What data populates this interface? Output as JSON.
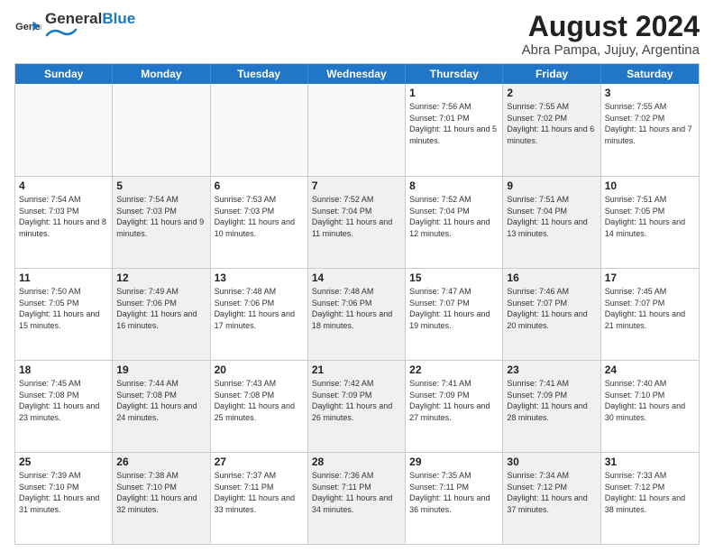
{
  "header": {
    "logo_general": "General",
    "logo_blue": "Blue",
    "month_year": "August 2024",
    "location": "Abra Pampa, Jujuy, Argentina"
  },
  "weekdays": [
    "Sunday",
    "Monday",
    "Tuesday",
    "Wednesday",
    "Thursday",
    "Friday",
    "Saturday"
  ],
  "rows": [
    [
      {
        "day": "",
        "info": "",
        "shaded": false,
        "empty": true
      },
      {
        "day": "",
        "info": "",
        "shaded": false,
        "empty": true
      },
      {
        "day": "",
        "info": "",
        "shaded": false,
        "empty": true
      },
      {
        "day": "",
        "info": "",
        "shaded": false,
        "empty": true
      },
      {
        "day": "1",
        "info": "Sunrise: 7:56 AM\nSunset: 7:01 PM\nDaylight: 11 hours\nand 5 minutes.",
        "shaded": false,
        "empty": false
      },
      {
        "day": "2",
        "info": "Sunrise: 7:55 AM\nSunset: 7:02 PM\nDaylight: 11 hours\nand 6 minutes.",
        "shaded": true,
        "empty": false
      },
      {
        "day": "3",
        "info": "Sunrise: 7:55 AM\nSunset: 7:02 PM\nDaylight: 11 hours\nand 7 minutes.",
        "shaded": false,
        "empty": false
      }
    ],
    [
      {
        "day": "4",
        "info": "Sunrise: 7:54 AM\nSunset: 7:03 PM\nDaylight: 11 hours\nand 8 minutes.",
        "shaded": false,
        "empty": false
      },
      {
        "day": "5",
        "info": "Sunrise: 7:54 AM\nSunset: 7:03 PM\nDaylight: 11 hours\nand 9 minutes.",
        "shaded": true,
        "empty": false
      },
      {
        "day": "6",
        "info": "Sunrise: 7:53 AM\nSunset: 7:03 PM\nDaylight: 11 hours\nand 10 minutes.",
        "shaded": false,
        "empty": false
      },
      {
        "day": "7",
        "info": "Sunrise: 7:52 AM\nSunset: 7:04 PM\nDaylight: 11 hours\nand 11 minutes.",
        "shaded": true,
        "empty": false
      },
      {
        "day": "8",
        "info": "Sunrise: 7:52 AM\nSunset: 7:04 PM\nDaylight: 11 hours\nand 12 minutes.",
        "shaded": false,
        "empty": false
      },
      {
        "day": "9",
        "info": "Sunrise: 7:51 AM\nSunset: 7:04 PM\nDaylight: 11 hours\nand 13 minutes.",
        "shaded": true,
        "empty": false
      },
      {
        "day": "10",
        "info": "Sunrise: 7:51 AM\nSunset: 7:05 PM\nDaylight: 11 hours\nand 14 minutes.",
        "shaded": false,
        "empty": false
      }
    ],
    [
      {
        "day": "11",
        "info": "Sunrise: 7:50 AM\nSunset: 7:05 PM\nDaylight: 11 hours\nand 15 minutes.",
        "shaded": false,
        "empty": false
      },
      {
        "day": "12",
        "info": "Sunrise: 7:49 AM\nSunset: 7:06 PM\nDaylight: 11 hours\nand 16 minutes.",
        "shaded": true,
        "empty": false
      },
      {
        "day": "13",
        "info": "Sunrise: 7:48 AM\nSunset: 7:06 PM\nDaylight: 11 hours\nand 17 minutes.",
        "shaded": false,
        "empty": false
      },
      {
        "day": "14",
        "info": "Sunrise: 7:48 AM\nSunset: 7:06 PM\nDaylight: 11 hours\nand 18 minutes.",
        "shaded": true,
        "empty": false
      },
      {
        "day": "15",
        "info": "Sunrise: 7:47 AM\nSunset: 7:07 PM\nDaylight: 11 hours\nand 19 minutes.",
        "shaded": false,
        "empty": false
      },
      {
        "day": "16",
        "info": "Sunrise: 7:46 AM\nSunset: 7:07 PM\nDaylight: 11 hours\nand 20 minutes.",
        "shaded": true,
        "empty": false
      },
      {
        "day": "17",
        "info": "Sunrise: 7:45 AM\nSunset: 7:07 PM\nDaylight: 11 hours\nand 21 minutes.",
        "shaded": false,
        "empty": false
      }
    ],
    [
      {
        "day": "18",
        "info": "Sunrise: 7:45 AM\nSunset: 7:08 PM\nDaylight: 11 hours\nand 23 minutes.",
        "shaded": false,
        "empty": false
      },
      {
        "day": "19",
        "info": "Sunrise: 7:44 AM\nSunset: 7:08 PM\nDaylight: 11 hours\nand 24 minutes.",
        "shaded": true,
        "empty": false
      },
      {
        "day": "20",
        "info": "Sunrise: 7:43 AM\nSunset: 7:08 PM\nDaylight: 11 hours\nand 25 minutes.",
        "shaded": false,
        "empty": false
      },
      {
        "day": "21",
        "info": "Sunrise: 7:42 AM\nSunset: 7:09 PM\nDaylight: 11 hours\nand 26 minutes.",
        "shaded": true,
        "empty": false
      },
      {
        "day": "22",
        "info": "Sunrise: 7:41 AM\nSunset: 7:09 PM\nDaylight: 11 hours\nand 27 minutes.",
        "shaded": false,
        "empty": false
      },
      {
        "day": "23",
        "info": "Sunrise: 7:41 AM\nSunset: 7:09 PM\nDaylight: 11 hours\nand 28 minutes.",
        "shaded": true,
        "empty": false
      },
      {
        "day": "24",
        "info": "Sunrise: 7:40 AM\nSunset: 7:10 PM\nDaylight: 11 hours\nand 30 minutes.",
        "shaded": false,
        "empty": false
      }
    ],
    [
      {
        "day": "25",
        "info": "Sunrise: 7:39 AM\nSunset: 7:10 PM\nDaylight: 11 hours\nand 31 minutes.",
        "shaded": false,
        "empty": false
      },
      {
        "day": "26",
        "info": "Sunrise: 7:38 AM\nSunset: 7:10 PM\nDaylight: 11 hours\nand 32 minutes.",
        "shaded": true,
        "empty": false
      },
      {
        "day": "27",
        "info": "Sunrise: 7:37 AM\nSunset: 7:11 PM\nDaylight: 11 hours\nand 33 minutes.",
        "shaded": false,
        "empty": false
      },
      {
        "day": "28",
        "info": "Sunrise: 7:36 AM\nSunset: 7:11 PM\nDaylight: 11 hours\nand 34 minutes.",
        "shaded": true,
        "empty": false
      },
      {
        "day": "29",
        "info": "Sunrise: 7:35 AM\nSunset: 7:11 PM\nDaylight: 11 hours\nand 36 minutes.",
        "shaded": false,
        "empty": false
      },
      {
        "day": "30",
        "info": "Sunrise: 7:34 AM\nSunset: 7:12 PM\nDaylight: 11 hours\nand 37 minutes.",
        "shaded": true,
        "empty": false
      },
      {
        "day": "31",
        "info": "Sunrise: 7:33 AM\nSunset: 7:12 PM\nDaylight: 11 hours\nand 38 minutes.",
        "shaded": false,
        "empty": false
      }
    ]
  ]
}
